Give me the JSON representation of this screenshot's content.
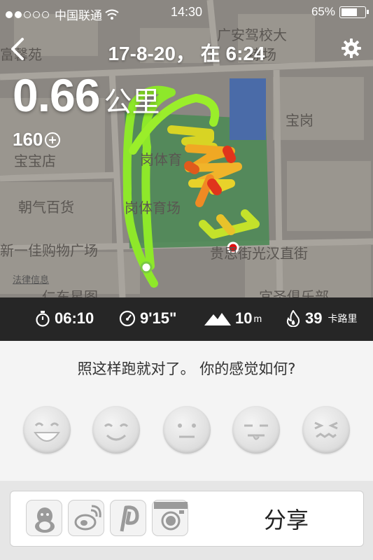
{
  "status_bar": {
    "carrier": "中国联通",
    "time": "14:30",
    "battery": "65%"
  },
  "header": {
    "title": "17-8-20， 在 6:24"
  },
  "summary": {
    "distance_value": "0.66",
    "distance_unit": "公里",
    "fuel": "160"
  },
  "map": {
    "labels": [
      "广安驾校大",
      "练场",
      "富馨苑",
      "宝岗",
      "宝宝店",
      "岗体育",
      "朝气百货",
      "岗体育场",
      "新一佳购物广场",
      "贵思街光汉直街",
      "宜圣俱乐部",
      "仁东星图"
    ],
    "legal": "法律信息"
  },
  "stats": {
    "duration": "06:10",
    "pace": "9'15\"",
    "elevation": "10",
    "elevation_unit": "m",
    "calories": "39",
    "calories_unit": "卡路里"
  },
  "feel": {
    "question": "照这样跑就对了。 你的感觉如何?",
    "faces": [
      "great-face-icon",
      "happy-face-icon",
      "neutral-face-icon",
      "unhappy-face-icon",
      "exhausted-face-icon"
    ]
  },
  "share": {
    "label": "分享",
    "icons": [
      "qq-icon",
      "weibo-icon",
      "path-icon",
      "instagram-icon"
    ]
  },
  "colors": {
    "stats_bar": "#262626",
    "route_green": "#8ee82a",
    "route_red": "#e0341c",
    "start_marker": "#7ac943",
    "end_marker": "#e01010"
  }
}
